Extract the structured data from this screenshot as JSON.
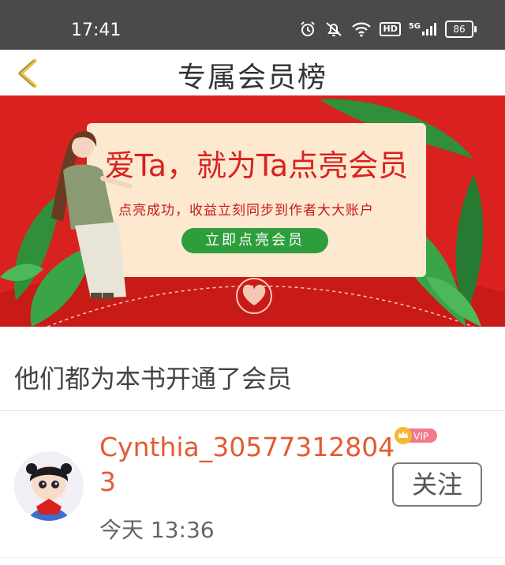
{
  "status_bar": {
    "time": "17:41",
    "hd_label": "HD",
    "network_label": "5G",
    "battery": "86"
  },
  "nav": {
    "title": "专属会员榜"
  },
  "banner": {
    "headline": "爱Ta，就为Ta点亮会员",
    "subline": "点亮成功，收益立刻同步到作者大大账户",
    "cta_label": "立即点亮会员"
  },
  "section": {
    "title": "他们都为本书开通了会员"
  },
  "members": [
    {
      "username": "Cynthia_305773128043",
      "badge": "VIP",
      "timestamp": "今天 13:36",
      "follow_label": "关注"
    }
  ],
  "colors": {
    "banner_red": "#d9221f",
    "username": "#e35b33",
    "cta_green": "#2e9e3d"
  }
}
